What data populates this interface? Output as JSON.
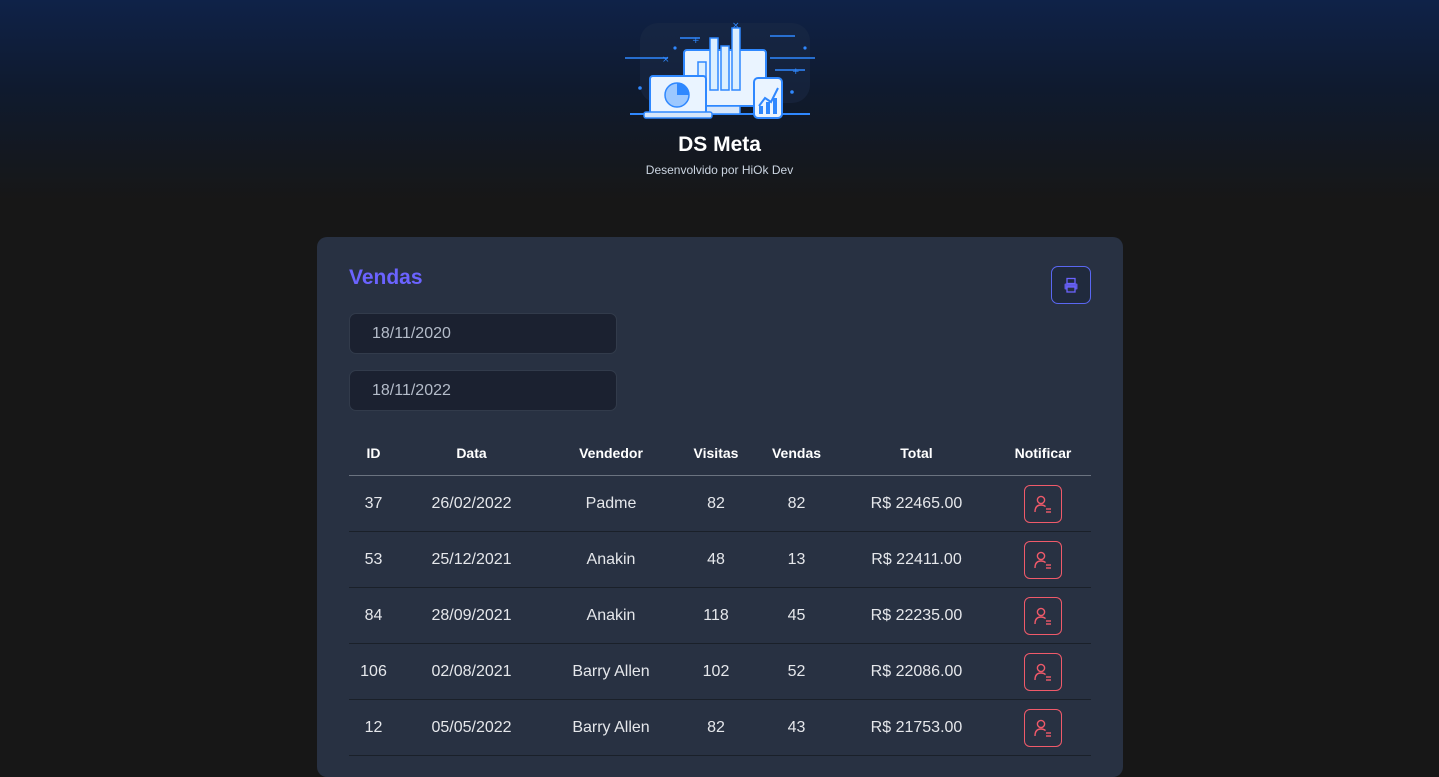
{
  "header": {
    "title": "DS Meta",
    "subtitle": "Desenvolvido por HiOk Dev"
  },
  "sales": {
    "title": "Vendas",
    "min_date": "18/11/2020",
    "max_date": "18/11/2022",
    "columns": [
      "ID",
      "Data",
      "Vendedor",
      "Visitas",
      "Vendas",
      "Total",
      "Notificar"
    ],
    "rows": [
      {
        "id": "37",
        "date": "26/02/2022",
        "seller": "Padme",
        "visits": "82",
        "deals": "82",
        "total": "R$ 22465.00"
      },
      {
        "id": "53",
        "date": "25/12/2021",
        "seller": "Anakin",
        "visits": "48",
        "deals": "13",
        "total": "R$ 22411.00"
      },
      {
        "id": "84",
        "date": "28/09/2021",
        "seller": "Anakin",
        "visits": "118",
        "deals": "45",
        "total": "R$ 22235.00"
      },
      {
        "id": "106",
        "date": "02/08/2021",
        "seller": "Barry Allen",
        "visits": "102",
        "deals": "52",
        "total": "R$ 22086.00"
      },
      {
        "id": "12",
        "date": "05/05/2022",
        "seller": "Barry Allen",
        "visits": "82",
        "deals": "43",
        "total": "R$ 21753.00"
      }
    ]
  },
  "icons": {
    "print": "printer-icon",
    "notify": "user-notify-icon",
    "logo": "analytics-devices-illustration"
  },
  "colors": {
    "accent": "#6b63ff",
    "notify": "#f05a6a",
    "card": "#283142",
    "background": "#171717"
  }
}
